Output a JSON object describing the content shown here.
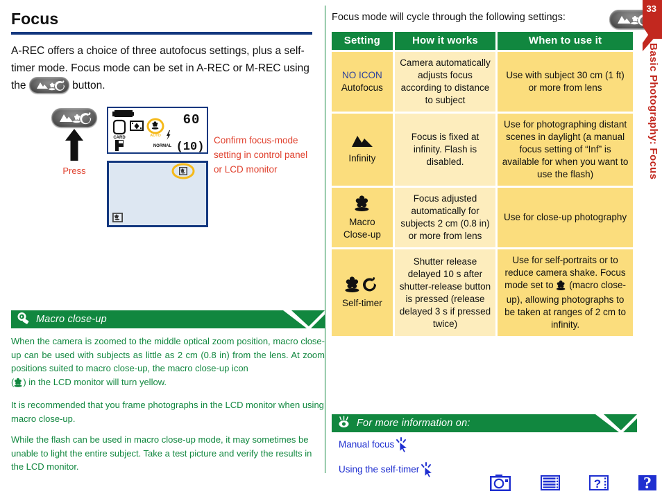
{
  "page": {
    "title": "Focus",
    "number": "33",
    "side_tab_text": "Basic Photography: Focus"
  },
  "intro": {
    "text_before_button": "A-REC offers a choice of three autofocus settings, plus a self-timer mode.  Focus mode can be set in A-REC or M-REC using the ",
    "text_after_button": " button."
  },
  "illustration": {
    "press_label": "Press",
    "confirm_note": "Confirm focus-mode setting in control panel or LCD monitor",
    "control_panel": {
      "card_label": "CARD",
      "mode_label": "P",
      "quality_label": "NORMAL",
      "shutter_speed": "60",
      "frames_remaining": "(10)",
      "macro_auto_label": "AUTO"
    }
  },
  "tip_box": {
    "header": "Macro close-up",
    "header_icon": "magnifier-icon",
    "paragraphs": [
      "When the camera is zoomed to the middle optical zoom position, macro close-up can be used with subjects as little as 2 cm (0.8 in) from the lens. At zoom positions suited to macro close-up, the macro close-up icon",
      "It is recommended that you frame photographs in the LCD monitor when using macro close-up.",
      "While the flash can be used in macro close-up mode, it may sometimes be unable to light the entire subject. Take a test picture and verify the results in the LCD monitor."
    ],
    "paragraph1_tail": ") in the LCD monitor will turn yellow.",
    "paragraph1_paren_open": "("
  },
  "right_column": {
    "lead_text": "Focus mode will cycle through the following settings:"
  },
  "table": {
    "headers": [
      "Setting",
      "How it works",
      "When to use it"
    ],
    "rows": [
      {
        "icon": "none",
        "no_icon_label": "NO ICON",
        "setting": "Autofocus",
        "how_it_works": "Camera automatically adjusts focus according to distance to subject",
        "when_to_use": "Use with subject 30 cm (1 ft) or more from lens"
      },
      {
        "icon": "mountain-icon",
        "no_icon_label": "",
        "setting": "Infinity",
        "how_it_works": "Focus is fixed at infinity.  Flash is disabled.",
        "when_to_use": "Use for photographing distant scenes in daylight (a manual focus setting of “Inf” is available for when you want to use the flash)"
      },
      {
        "icon": "flower-icon",
        "no_icon_label": "",
        "setting": "Macro\nClose-up",
        "how_it_works": "Focus adjusted automatically for subjects 2 cm (0.8 in) or more from lens",
        "when_to_use": "Use for close-up photography"
      },
      {
        "icon": "flower-timer-icon",
        "no_icon_label": "",
        "setting": "Self-timer",
        "how_it_works": "Shutter release delayed 10 s after shutter-release button is pressed (release delayed 3 s if pressed twice)",
        "when_to_use_before": "Use for self-portraits or to reduce camera shake. Focus mode set to ",
        "when_to_use_after": " (macro close-up), allowing photographs to be taken at ranges of 2 cm to infinity."
      }
    ]
  },
  "info_box": {
    "header": "For more information on:",
    "header_icon": "eye-idea-icon",
    "links": [
      {
        "label": "Manual focus",
        "icon": "cursor-icon"
      },
      {
        "label": "Using the self-timer",
        "icon": "cursor-icon"
      }
    ]
  },
  "bottom_nav": [
    {
      "name": "camera-icon"
    },
    {
      "name": "menu-list-icon"
    },
    {
      "name": "index-help-icon"
    },
    {
      "name": "question-mark-icon"
    }
  ],
  "colors": {
    "green": "#11873f",
    "navy": "#14387f",
    "red_note": "#e0412e",
    "tab_red": "#c2281f",
    "cell_dark": "#fbdd7d",
    "cell_light": "#fdedbd",
    "link_blue": "#1f2fd0",
    "no_icon_blue": "#2a3f9d"
  }
}
